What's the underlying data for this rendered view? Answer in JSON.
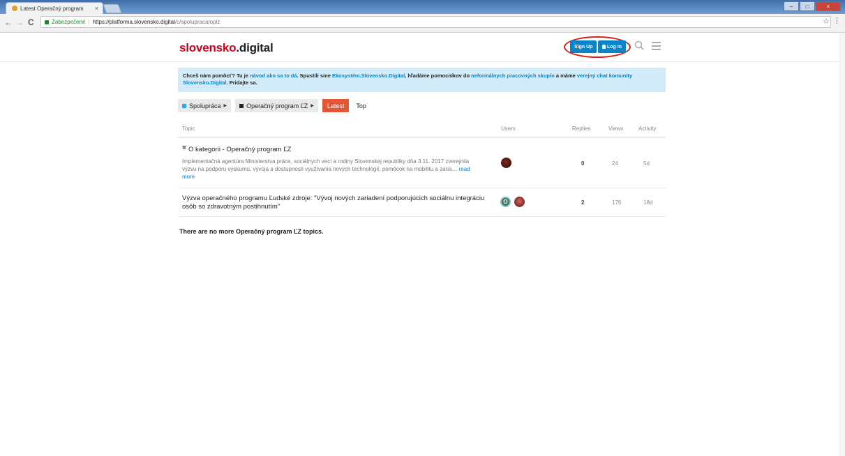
{
  "browser": {
    "tab_title": "Latest Operačný program",
    "tab_close": "×",
    "secure_label": "Zabezpečené",
    "url_host": "https://platforma.slovensko.digital",
    "url_path": "/c/spolupraca/oplz",
    "back": "←",
    "forward": "→",
    "reload": "C",
    "star": "☆",
    "menu": "⋮"
  },
  "header": {
    "logo_part1": "slovensko",
    "logo_part2": ".digital",
    "signup_label": "Sign Up",
    "login_label": "Log In"
  },
  "banner": {
    "t1": "Chceš nám pomôcť? Tu je ",
    "l1": "návod ako sa to dá",
    "t2": ". Spustili sme ",
    "l2": "Ekosystém.Slovensko.Digital",
    "t3": ", hľadáme pomocníkov do ",
    "l3": "neformálnych pracovných skupín",
    "t4": " a máme ",
    "l4": "verejný chat komunity Slovensko.Digital",
    "t5": ". Pridajte sa."
  },
  "filters": {
    "category": "Spolupráca",
    "subcategory": "Operačný program ĽZ",
    "latest": "Latest",
    "top": "Top"
  },
  "table": {
    "headers": {
      "topic": "Topic",
      "users": "Users",
      "replies": "Replies",
      "views": "Views",
      "activity": "Activity"
    },
    "rows": [
      {
        "title": "O kategorii - Operačný program ĽZ",
        "excerpt": "Implementačná agentúra Ministerstva práce, sociálnych vecí a rodiny Slovenskej republiky dňa 3.11. 2017 zverejnila výzvu na podporu výskumu, vývoja a dostupnosti využívania nových technológií, pomôcok na mobilitu a zaria…",
        "read_more": "read more",
        "replies": "0",
        "views": "24",
        "activity": "5d"
      },
      {
        "title": "Výzva operačného programu Ľudské zdroje: \"Vývoj nových zariadení podporujúcich sociálnu integráciu osôb so zdravotným postihnutím\"",
        "avatar_letter": "O",
        "replies": "2",
        "views": "176",
        "activity": "18d"
      }
    ]
  },
  "footer_message": "There are no more Operačný program ĽZ topics.",
  "colors": {
    "brand_red": "#d0021b",
    "primary_blue": "#0a84c9",
    "latest_orange": "#e45735",
    "banner_bg": "#d1ecf8",
    "annotation_red": "#d91e18"
  }
}
